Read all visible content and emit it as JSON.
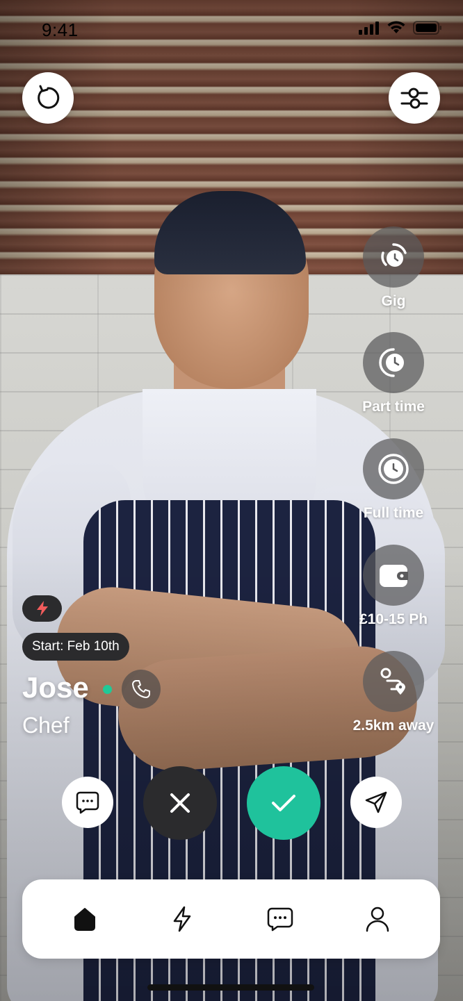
{
  "status_bar": {
    "time": "9:41"
  },
  "top_buttons": {
    "rewind_icon": "rewind-icon",
    "filter_icon": "sliders-icon"
  },
  "job_stats": [
    {
      "label": "Gig",
      "icon": "clock-quarter-icon"
    },
    {
      "label": "Part time",
      "icon": "clock-half-icon"
    },
    {
      "label": "Full time",
      "icon": "clock-full-icon"
    },
    {
      "label": "£10-15 Ph",
      "icon": "wallet-icon"
    },
    {
      "label": "2.5km away",
      "icon": "route-icon"
    }
  ],
  "candidate": {
    "start": "Start: Feb 10th",
    "name": "Jose",
    "role": "Chef",
    "online": true
  },
  "actions": {
    "chat": "chat-icon",
    "reject": "close-icon",
    "accept": "check-icon",
    "send": "send-icon"
  },
  "nav": {
    "items": [
      "home-icon",
      "bolt-icon",
      "messages-icon",
      "profile-icon"
    ],
    "active": "home-icon"
  },
  "colors": {
    "accent": "#1fc29c",
    "dark": "#2b2b2d",
    "online": "#20c997",
    "bolt": "#f25c5c"
  }
}
